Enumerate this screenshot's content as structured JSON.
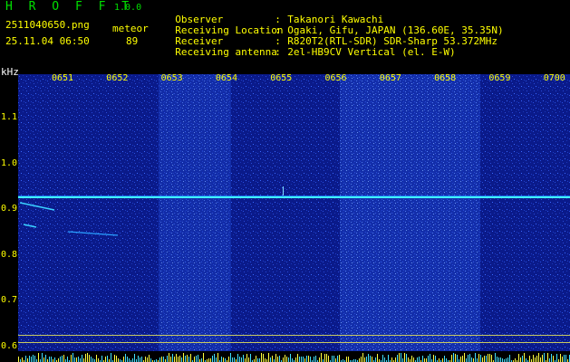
{
  "app": {
    "title": "H R O F F T",
    "version": "1.0.0"
  },
  "file": {
    "name": "2511040650.png",
    "timestamp": "25.11.04 06:50"
  },
  "meteor": {
    "label": "meteor",
    "count": "89"
  },
  "info": [
    {
      "key": "Observer",
      "value": "Takanori Kawachi"
    },
    {
      "key": "Receiving Location",
      "value": "Ogaki, Gifu, JAPAN (136.60E, 35.35N)"
    },
    {
      "key": "Receiver",
      "value": "R820T2(RTL-SDR) SDR-Sharp 53.372MHz"
    },
    {
      "key": "Receiving antenna",
      "value": "2el-HB9CV Vertical (el. E-W)"
    }
  ],
  "axis": {
    "unit": "kHz",
    "time_ticks": [
      "0651",
      "0652",
      "0653",
      "0654",
      "0655",
      "0656",
      "0657",
      "0658",
      "0659",
      "0700"
    ],
    "freq_ticks": [
      "1.1",
      "1.0",
      "0.9",
      "0.8",
      "0.7",
      "0.6"
    ]
  },
  "colors": {
    "background": "#000000",
    "spectrum_base": "#0a1a8a",
    "carrier_line": "#40ffff",
    "grid_line": "#ffff00",
    "text_yellow": "#ffff00",
    "text_green": "#00e000"
  }
}
